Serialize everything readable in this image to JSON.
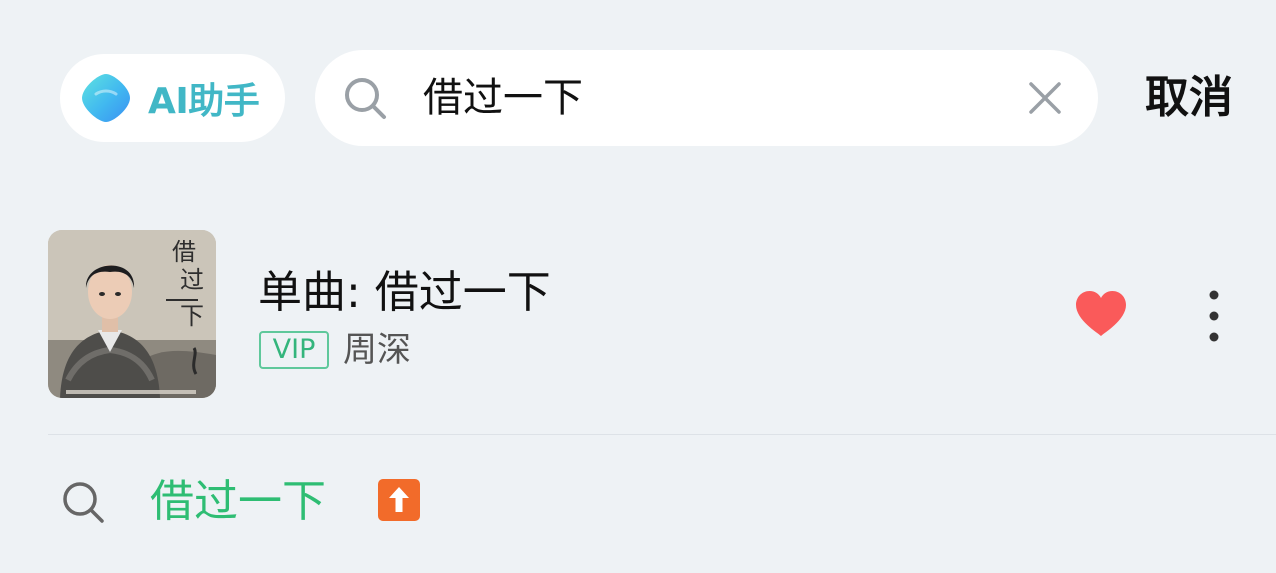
{
  "ai_assistant": {
    "label": "AI助手",
    "logo_icon": "ai-assistant-logo-icon"
  },
  "search": {
    "query": "借过一下",
    "search_icon": "search-icon",
    "clear_icon": "close-icon"
  },
  "cancel_label": "取消",
  "result": {
    "title": "单曲: 借过一下",
    "vip_badge": "VIP",
    "artist": "周深",
    "cover_text": "借过一下",
    "favorite_icon": "heart-icon",
    "more_icon": "more-vertical-icon"
  },
  "suggestion": {
    "text": "借过一下",
    "search_icon": "search-icon",
    "trend_icon": "trending-up-arrow-icon"
  },
  "colors": {
    "background": "#eef2f5",
    "accent_green": "#2ebd73",
    "vip_green": "#34b57c",
    "heart_red": "#fa5a5a",
    "trend_orange": "#f26b2a",
    "ai_label": "#41b7c6"
  }
}
